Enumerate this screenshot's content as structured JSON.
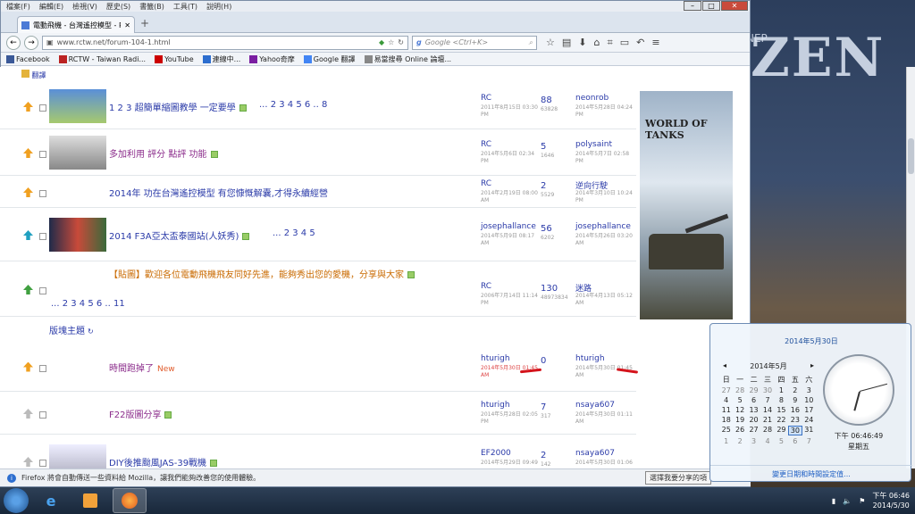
{
  "menu": [
    "檔案(F)",
    "編輯(E)",
    "檢視(V)",
    "歷史(S)",
    "書籤(B)",
    "工具(T)",
    "說明(H)"
  ],
  "tab": {
    "title": "電動飛機 - 台灣遙控模型 - RC..."
  },
  "url": "www.rctw.net/forum-104-1.html",
  "search_placeholder": "Google <Ctrl+K>",
  "bookmarks": [
    "Facebook",
    "RCTW - Taiwan Radi...",
    "YouTube",
    "連線中...",
    "Yahoo奇摩",
    "Google 翻譯",
    "易當搜尋 Online 論壇..."
  ],
  "topbar_label": "翻譯",
  "threads": [
    {
      "title": "1 2 3 超簡單縮圖教學 一定要學",
      "pages": "... 2 3 4 5 6 .. 8",
      "author": "RC",
      "adate": "2011年8月15日 03:30 PM",
      "replies": "88",
      "views": "63828",
      "lastuser": "neonrob",
      "ldate": "2014年5月28日 04:24 PM"
    },
    {
      "title": "多加利用 評分 點評 功能",
      "pages": "",
      "author": "RC",
      "adate": "2014年5月6日 02:34 PM",
      "replies": "5",
      "views": "1646",
      "lastuser": "polysaint",
      "ldate": "2014年5月7日 02:58 PM"
    },
    {
      "title": "2014年 功在台灣遙控模型 有您慷慨解囊,才得永續經營",
      "pages": "",
      "author": "RC",
      "adate": "2014年2月19日 08:00 AM",
      "replies": "2",
      "views": "5529",
      "lastuser": "逆向行駛",
      "ldate": "2014年3月10日 10:24 PM"
    },
    {
      "title": "2014 F3A亞太盃泰國站(人妖秀)",
      "pages": "... 2 3 4 5",
      "author": "josephallance",
      "adate": "2014年5月9日 08:17 AM",
      "replies": "56",
      "views": "6202",
      "lastuser": "josephallance",
      "ldate": "2014年5月26日 03:20 AM"
    },
    {
      "title": "【貼圖】歡迎各位電動飛機飛友同好先進，能夠秀出您的愛機，分享與大家",
      "pages": "... 2 3 4 5 6 .. 11",
      "author": "RC",
      "adate": "2006年7月14日 11:14 PM",
      "replies": "130",
      "views": "48973834",
      "lastuser": "迷路",
      "ldate": "2014年4月13日 05:12 AM"
    },
    {
      "title": "時間跑掉了",
      "new": "New",
      "author": "hturigh",
      "adate": "2014年5月30日 01:45 AM",
      "replies": "0",
      "views": "",
      "lastuser": "hturigh",
      "ldate": "2014年5月30日 01:45 AM"
    },
    {
      "title": "F22版圖分享",
      "author": "hturigh",
      "adate": "2014年5月28日 02:05 PM",
      "replies": "7",
      "views": "317",
      "lastuser": "nsaya607",
      "ldate": "2014年5月30日 01:11 AM"
    },
    {
      "title": "DIY後推颱風JAS-39戰機",
      "author": "EF2000",
      "adate": "2014年5月29日 09:49",
      "replies": "2",
      "views": "142",
      "lastuser": "nsaya607",
      "ldate": "2014年5月30日 01:06"
    }
  ],
  "section_label": "版塊主題",
  "ad": {
    "title": "WORLD OF TANKS"
  },
  "status": {
    "text": "Firefox 將會自動傳送一些資料給 Mozilla，讓我們能夠改善您的使用體驗。",
    "button": "選擇我要分享的項"
  },
  "calendar": {
    "header": "2014年5月30日",
    "month": "2014年5月",
    "weekdays": [
      "日",
      "一",
      "二",
      "三",
      "四",
      "五",
      "六"
    ],
    "days": [
      "27",
      "28",
      "29",
      "30",
      "1",
      "2",
      "3",
      "4",
      "5",
      "6",
      "7",
      "8",
      "9",
      "10",
      "11",
      "12",
      "13",
      "14",
      "15",
      "16",
      "17",
      "18",
      "19",
      "20",
      "21",
      "22",
      "23",
      "24",
      "25",
      "26",
      "27",
      "28",
      "29",
      "30",
      "31",
      "1",
      "2",
      "3",
      "4",
      "5",
      "6",
      "7"
    ],
    "time": "下午 06:46:49",
    "weekday": "星期五",
    "link": "變更日期和時間設定值..."
  },
  "tray": {
    "time": "下午 06:46",
    "date": "2014/5/30"
  }
}
